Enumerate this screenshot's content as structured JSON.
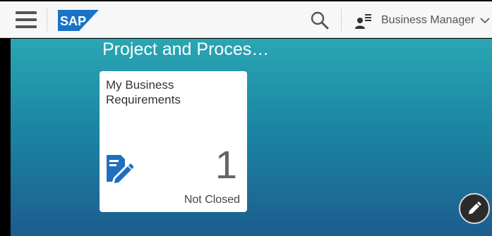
{
  "header": {
    "logo_text": "SAP",
    "user_name": "Business Manager"
  },
  "group": {
    "title": "Project and Proces…"
  },
  "tile": {
    "title": "My Business Requirements",
    "number": "1",
    "footer": "Not Closed"
  },
  "icons": {
    "menu": "hamburger-menu-icon",
    "search": "search-icon",
    "user": "user-icon",
    "dropdown": "chevron-down-icon",
    "tile": "document-edit-icon",
    "edit": "pencil-icon"
  },
  "colors": {
    "sap_blue": "#1a73c7",
    "tile_icon": "#1f6fc0",
    "canvas_top": "#2aa6b2",
    "canvas_bottom": "#1c5d8e"
  }
}
